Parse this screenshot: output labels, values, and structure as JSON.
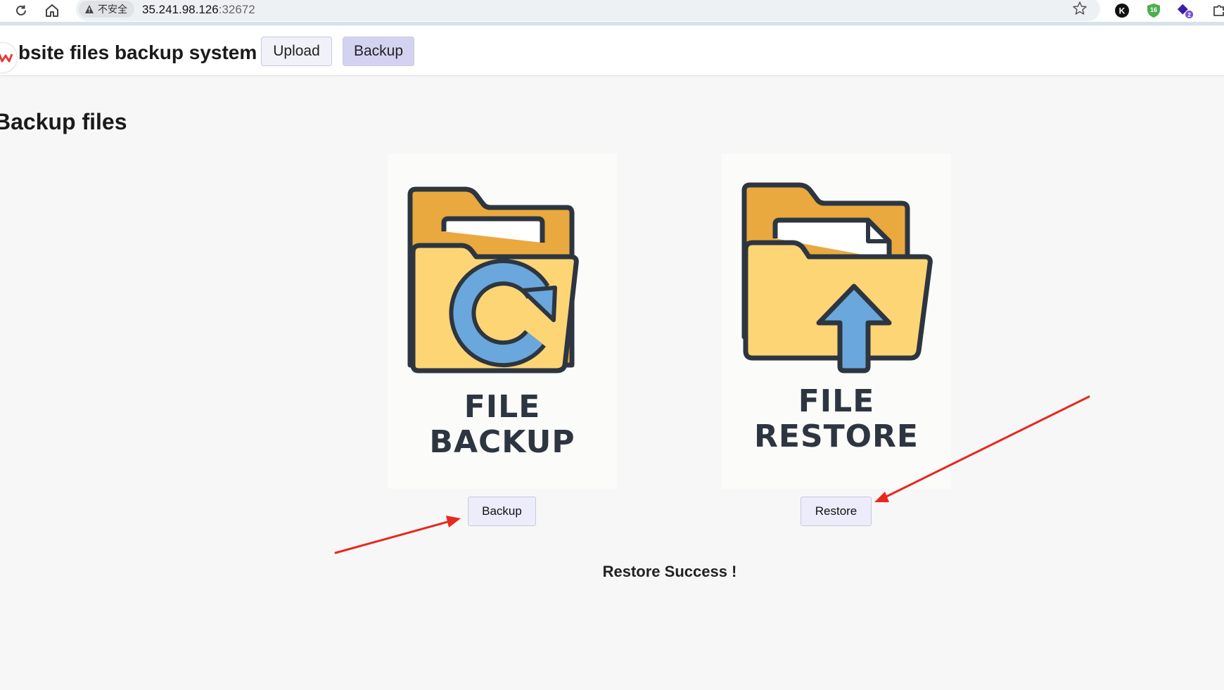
{
  "browser": {
    "security_label": "不安全",
    "url_host": "35.241.98.126",
    "url_port": ":32672",
    "extensions": [
      {
        "icon": "k-extension-icon",
        "text": "K"
      },
      {
        "icon": "shield-extension-icon",
        "text": "16"
      },
      {
        "icon": "purple-extension-icon",
        "text": "2"
      }
    ]
  },
  "header": {
    "title": "bsite files backup system",
    "nav": [
      {
        "label": "Upload"
      },
      {
        "label": "Backup"
      }
    ]
  },
  "main": {
    "heading": "Backup files",
    "cards": [
      {
        "image_line1": "FILE",
        "image_line2": "BACKUP",
        "button_label": "Backup"
      },
      {
        "image_line1": "FILE",
        "image_line2": "RESTORE",
        "button_label": "Restore"
      }
    ],
    "status_message": "Restore Success !"
  },
  "colors": {
    "folder_back": "#e9a93f",
    "folder_front": "#fdd575",
    "outline": "#2d3640",
    "icon_blue": "#6aa7dc",
    "active_tab": "#d3d3f1",
    "annotation_arrow": "#e8281e"
  }
}
